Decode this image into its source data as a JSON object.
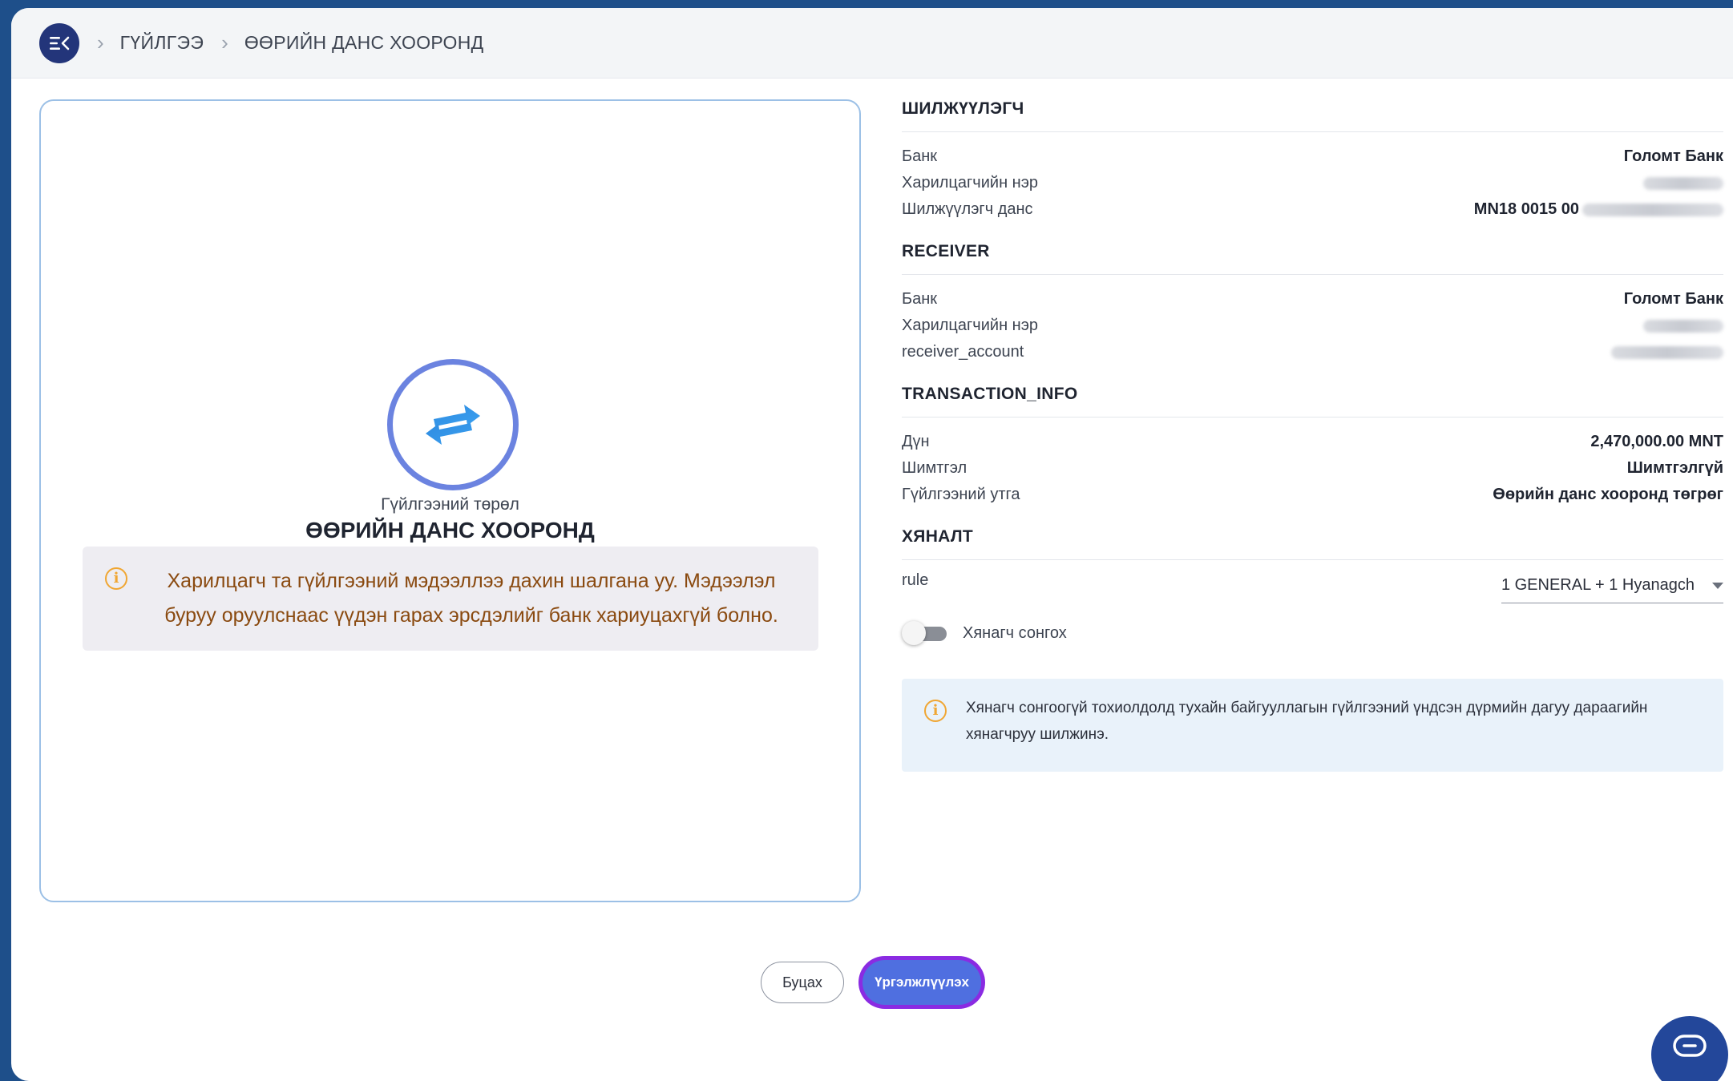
{
  "breadcrumb": {
    "items": [
      "ГҮЙЛГЭЭ",
      "ӨӨРИЙН ДАНС ХООРОНД"
    ],
    "separator": ">"
  },
  "left_card": {
    "type_label": "Гүйлгээний төрөл",
    "type_value": "ӨӨРИЙН ДАНС ХООРОНД",
    "warning_text": "Харилцагч та гүйлгээний мэдээллээ дахин шалгана уу. Мэдээлэл буруу оруулснаас үүдэн гарах эрсдэлийг банк хариуцахгүй болно."
  },
  "sender": {
    "title": "ШИЛЖҮҮЛЭГЧ",
    "bank_label": "Банк",
    "bank_value": "Голомт Банк",
    "name_label": "Харилцагчийн нэр",
    "account_label": "Шилжүүлэгч данс",
    "account_value": "MN18 0015 00"
  },
  "receiver": {
    "title": "RECEIVER",
    "bank_label": "Банк",
    "bank_value": "Голомт Банк",
    "name_label": "Харилцагчийн нэр",
    "account_label": "receiver_account"
  },
  "transaction_info": {
    "title": "TRANSACTION_INFO",
    "amount_label": "Дүн",
    "amount_value": "2,470,000.00 MNT",
    "fee_label": "Шимтгэл",
    "fee_value": "Шимтгэлгүй",
    "description_label": "Гүйлгээний утга",
    "description_value": "Өөрийн данс хооронд төгрөг"
  },
  "control": {
    "title": "ХЯНАЛТ",
    "rule_label": "rule",
    "rule_value": "1 GENERAL + 1 Hyanagch",
    "toggle_label": "Хянагч сонгох",
    "toggle_on": false,
    "info_text": "Хянагч сонгоогүй тохиолдолд тухайн байгууллагын гүйлгээний үндсэн дүрмийн дагуу дараагийн хянагчруу шилжинэ."
  },
  "buttons": {
    "back": "Буцах",
    "continue": "Үргэлжлүүлэх"
  },
  "colors": {
    "accent": "#4f6fe0",
    "continue_ring": "#8a2be2",
    "warning": "#f0a632",
    "background_frame": "#1e4f8a"
  }
}
